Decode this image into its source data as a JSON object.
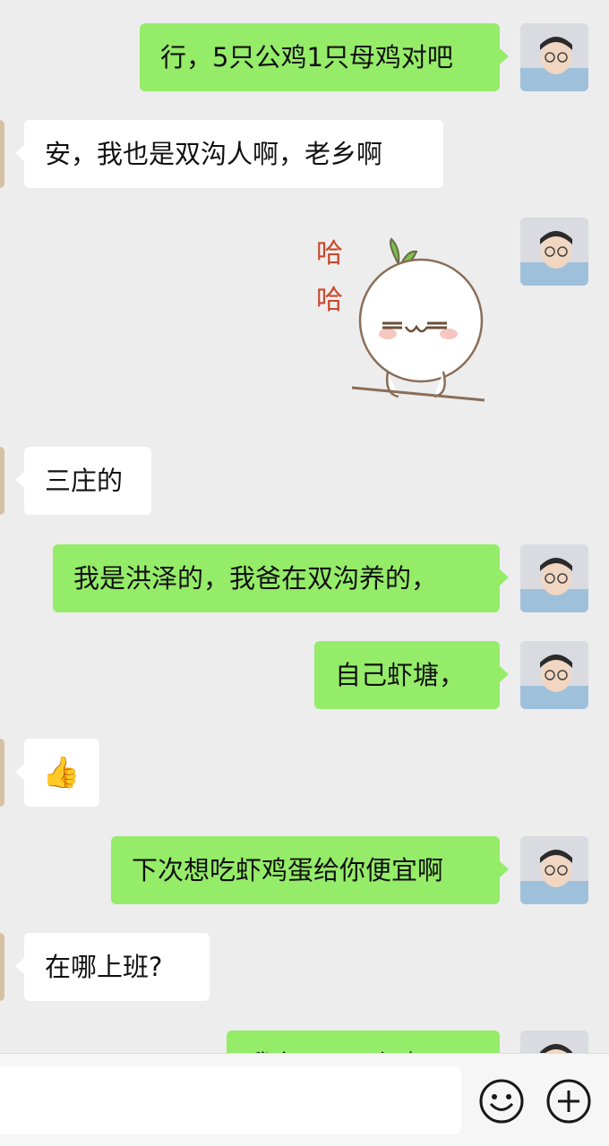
{
  "messages": [
    {
      "side": "out",
      "text": "行，5只公鸡1只母鸡对吧"
    },
    {
      "side": "in",
      "text": "安，我也是双沟人啊，老乡啊"
    },
    {
      "side": "out",
      "type": "sticker",
      "sticker_text_1": "哈",
      "sticker_text_2": "哈"
    },
    {
      "side": "in",
      "text": "三庄的"
    },
    {
      "side": "out",
      "text": "我是洪泽的，我爸在双沟养的，"
    },
    {
      "side": "out",
      "text": "自己虾塘，"
    },
    {
      "side": "in",
      "emoji": "👍"
    },
    {
      "side": "out",
      "text": "下次想吃虾鸡蛋给你便宜啊"
    },
    {
      "side": "in",
      "text": "在哪上班?"
    },
    {
      "side": "out",
      "text": "我在XXXX上班"
    }
  ],
  "input": {
    "value": "",
    "placeholder": ""
  },
  "icons": {
    "emoji": "smiley-face-icon",
    "more": "plus-circle-icon"
  },
  "colors": {
    "outgoing_bubble": "#95ec69",
    "incoming_bubble": "#ffffff",
    "background": "#ededed"
  }
}
